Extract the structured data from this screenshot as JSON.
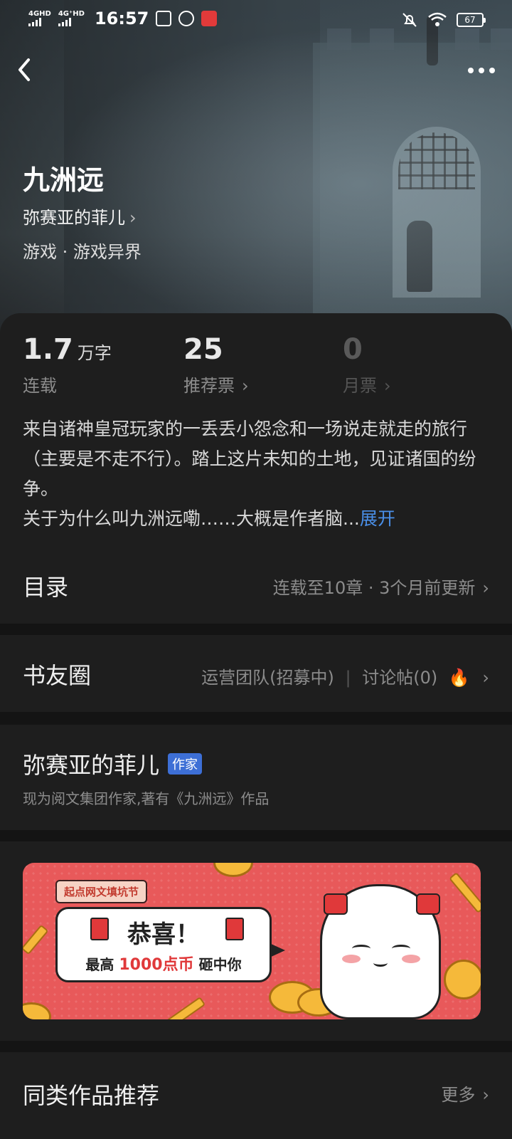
{
  "status_bar": {
    "network_1": "4GHD",
    "network_2": "4G⁺HD",
    "time": "16:57",
    "battery": "67"
  },
  "book": {
    "title": "九洲远",
    "author": "弥赛亚的菲儿",
    "genre": "游戏 · 游戏异界"
  },
  "stats": [
    {
      "value": "1.7",
      "unit": "万字",
      "label": "连载"
    },
    {
      "value": "25",
      "unit": "",
      "label": "推荐票"
    },
    {
      "value": "0",
      "unit": "",
      "label": "月票"
    }
  ],
  "description": {
    "text": "来自诸神皇冠玩家的一丢丢小怨念和一场说走就走的旅行（主要是不走不行）。踏上这片未知的土地，见证诸国的纷争。\n关于为什么叫九洲远嘞……大概是作者脑...",
    "expand_label": "展开"
  },
  "toc": {
    "title": "目录",
    "status": "连载至10章 · 3个月前更新"
  },
  "circle": {
    "title": "书友圈",
    "team": "运营团队(招募中)",
    "posts": "讨论帖(0)"
  },
  "author_section": {
    "name": "弥赛亚的菲儿",
    "badge": "作家",
    "bio": "现为阅文集团作家,著有《九洲远》作品"
  },
  "banner": {
    "tag": "起点网文填坑节",
    "headline": "恭喜！",
    "prize_prefix": "最高",
    "prize_amount": "1000点币",
    "prize_suffix": "砸中你"
  },
  "recommend": {
    "title": "同类作品推荐",
    "more": "更多"
  },
  "colors": {
    "background": "#141414",
    "card": "#1e1e1e",
    "accent_link": "#4a8fe8",
    "badge": "#3d6fd6",
    "banner": "#e8595a"
  }
}
